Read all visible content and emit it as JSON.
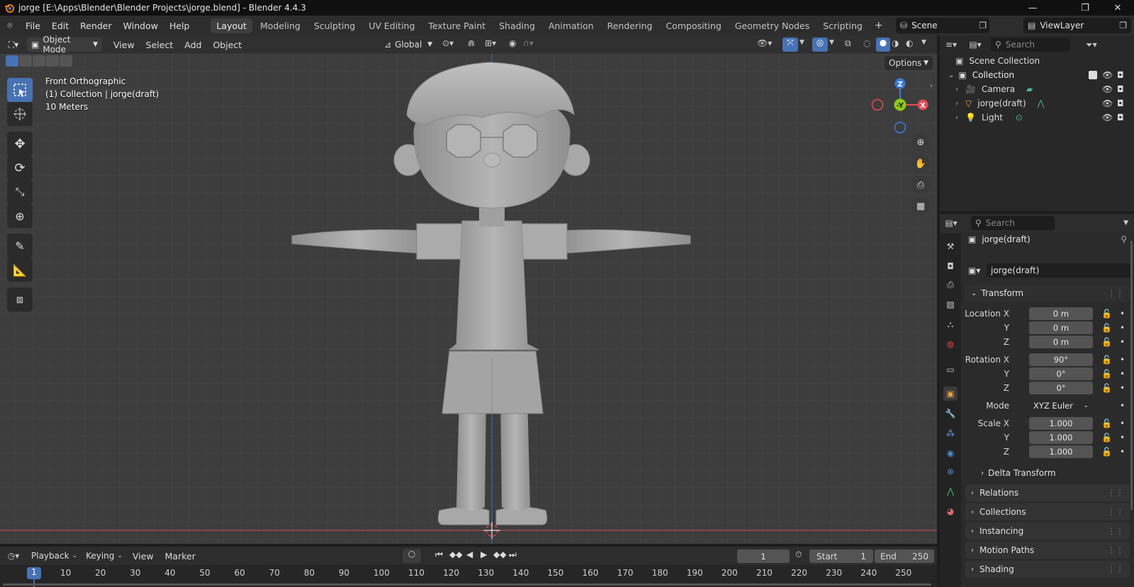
{
  "window": {
    "title": "jorge [E:\\Apps\\Blender\\Blender Projects\\jorge.blend] - Blender 4.4.3"
  },
  "menus": [
    "File",
    "Edit",
    "Render",
    "Window",
    "Help"
  ],
  "workspaces": [
    "Layout",
    "Modeling",
    "Sculpting",
    "UV Editing",
    "Texture Paint",
    "Shading",
    "Animation",
    "Rendering",
    "Compositing",
    "Geometry Nodes",
    "Scripting"
  ],
  "active_workspace": "Layout",
  "scene": {
    "name": "Scene",
    "view_layer": "ViewLayer"
  },
  "viewport_header": {
    "mode": "Object Mode",
    "menus": [
      "View",
      "Select",
      "Add",
      "Object"
    ],
    "orientation": "Global",
    "options": "Options"
  },
  "overlay": {
    "view_name": "Front Orthographic",
    "collection_info": "(1) Collection | jorge(draft)",
    "scale": "10 Meters"
  },
  "gizmo": {
    "z": "Z",
    "y": "-Y",
    "x": "X"
  },
  "outliner": {
    "search_placeholder": "Search",
    "scene_collection": "Scene Collection",
    "collection": "Collection",
    "items": [
      {
        "name": "Camera"
      },
      {
        "name": "jorge(draft)"
      },
      {
        "name": "Light"
      }
    ]
  },
  "properties": {
    "search_placeholder": "Search",
    "object_name": "jorge(draft)",
    "datablock": "jorge(draft)",
    "transform_label": "Transform",
    "location_label": "Location X",
    "rotation_label": "Rotation X",
    "scale_label": "Scale X",
    "mode_label": "Mode",
    "mode_value": "XYZ Euler",
    "axis_y": "Y",
    "axis_z": "Z",
    "location": [
      "0 m",
      "0 m",
      "0 m"
    ],
    "rotation": [
      "90°",
      "0°",
      "0°"
    ],
    "scale": [
      "1.000",
      "1.000",
      "1.000"
    ],
    "delta_transform": "Delta Transform",
    "panels": [
      "Relations",
      "Collections",
      "Instancing",
      "Motion Paths",
      "Shading"
    ]
  },
  "timeline": {
    "menus": [
      "Playback",
      "Keying",
      "View",
      "Marker"
    ],
    "current_frame": "1",
    "start_label": "Start",
    "start": "1",
    "end_label": "End",
    "end": "250",
    "ruler": [
      "10",
      "20",
      "30",
      "40",
      "50",
      "60",
      "70",
      "80",
      "90",
      "100",
      "110",
      "120",
      "130",
      "140",
      "150",
      "160",
      "170",
      "180",
      "190",
      "200",
      "210",
      "220",
      "230",
      "240",
      "250"
    ],
    "playhead": "1"
  },
  "colors": {
    "accent": "#4772b3",
    "object_orange": "#e8a23c",
    "x_axis": "#e54a57",
    "y_axis": "#8ec919",
    "z_axis": "#3b7bd6"
  }
}
